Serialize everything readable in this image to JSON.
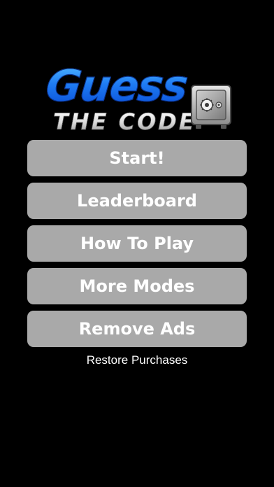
{
  "logo": {
    "line1": "Guess",
    "line2": "THE CODE",
    "icon": "safe-icon"
  },
  "menu": {
    "buttons": [
      {
        "label": "Start!"
      },
      {
        "label": "Leaderboard"
      },
      {
        "label": "How To Play"
      },
      {
        "label": "More Modes"
      },
      {
        "label": "Remove Ads"
      }
    ]
  },
  "restore": {
    "label": "Restore Purchases"
  },
  "colors": {
    "background": "#000000",
    "button": "#a9a9a9",
    "button_text": "#ffffff",
    "logo_blue": "#1f7cf3"
  }
}
